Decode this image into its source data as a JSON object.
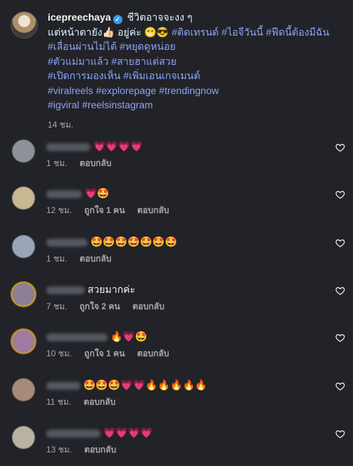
{
  "post": {
    "username": "icepreechaya",
    "verified_mark": "✓",
    "caption_line1": "ชีวิตอาจจะงง ๆ",
    "caption_line2": "แต่หน้าตายัง👍🏻 อยู่ค่ะ 😁😎",
    "tags_line2": "#ติดเทรนด์ #ไอจีวันนี้ #ฟีดนี้ต้องมีฉัน",
    "tags_line3": "#เลื่อนผ่านไม่ได้ #หยุดดูหน่อย",
    "tags_line4": "#ตัวแม่มาแล้ว #สายฮาแต่สวย",
    "tags_line5": "#เปิดการมองเห็น #เพิ่มเอนเกจเมนต์",
    "tags_line6": "#viralreels #explorepage #trendingnow",
    "tags_line7": "#igviral #reelsinstagram",
    "time": "14 ชม."
  },
  "comments": [
    {
      "text": "💗💗💗💗",
      "time": "1 ชม.",
      "likes": "",
      "reply": "ตอบกลับ",
      "avatar_color": "#8d9199"
    },
    {
      "text": "💗🤩",
      "time": "12 ชม.",
      "likes": "ถูกใจ 1 คน",
      "reply": "ตอบกลับ",
      "avatar_color": "#c9b892"
    },
    {
      "text": "🤩🤩🤩🤩🤩🤩🤩",
      "time": "1 ชม.",
      "likes": "",
      "reply": "ตอบกลับ",
      "avatar_color": "#9aa6b8"
    },
    {
      "text": "สวยมากค่ะ",
      "time": "7 ชม.",
      "likes": "ถูกใจ 2 คน",
      "reply": "ตอบกลับ",
      "avatar_color": "#8e7f98"
    },
    {
      "text": "🔥💗🤩",
      "time": "10 ชม.",
      "likes": "ถูกใจ 1 คน",
      "reply": "ตอบกลับ",
      "avatar_color": "#a07aa2"
    },
    {
      "text": "🤩🤩🤩💗💗🔥🔥🔥🔥🔥",
      "time": "11 ชม.",
      "likes": "",
      "reply": "ตอบกลับ",
      "avatar_color": "#a88a78"
    },
    {
      "text": "💗💗💗💗",
      "time": "13 ชม.",
      "likes": "",
      "reply": "ตอบกลับ",
      "avatar_color": "#b8b2a2"
    }
  ],
  "icons": {
    "like": "heart-outline-icon"
  }
}
